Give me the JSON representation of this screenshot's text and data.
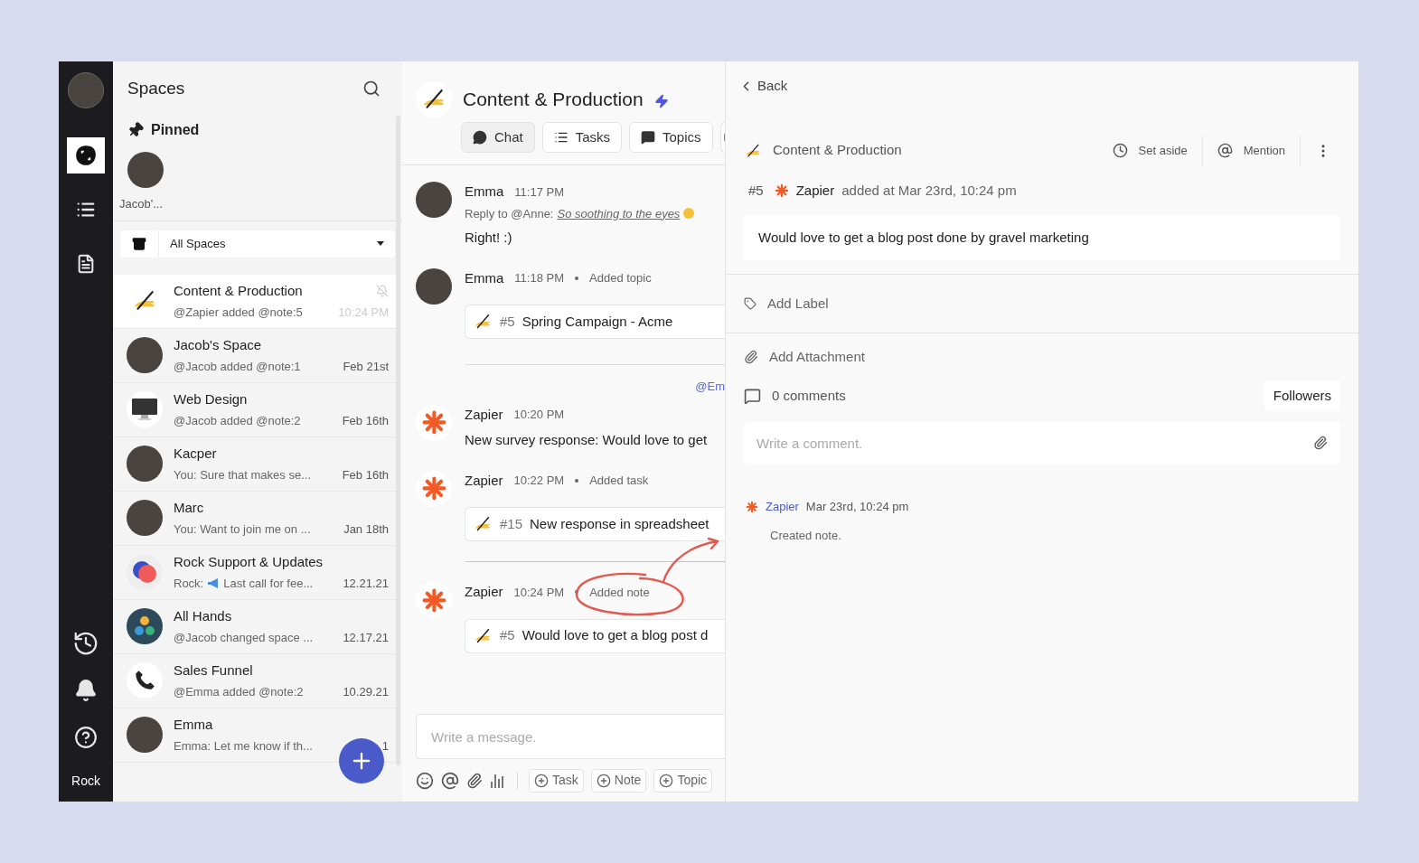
{
  "rail": {
    "top_items": [
      {
        "kind": "spaces",
        "selected": true
      },
      {
        "kind": "tasks",
        "selected": false
      },
      {
        "kind": "files",
        "selected": false
      }
    ],
    "bottom_items": [
      {
        "kind": "history"
      },
      {
        "kind": "notifications"
      },
      {
        "kind": "help"
      }
    ],
    "label": "Rock"
  },
  "spaces": {
    "title": "Spaces",
    "pinned": {
      "title": "Pinned",
      "items": [
        {
          "name": "Jacob'..."
        }
      ]
    },
    "filter": {
      "value": "All Spaces"
    },
    "items": [
      {
        "name": "Content & Production",
        "preview": "@Zapier added @note:5",
        "time": "10:24 PM",
        "avatar": {
          "kind": "writing"
        },
        "selected": true,
        "muted": true
      },
      {
        "name": "Jacob's Space",
        "preview": "@Jacob added @note:1",
        "time": "Feb 21st",
        "avatar": {
          "kind": "person"
        },
        "selected": false,
        "muted": false
      },
      {
        "name": "Web Design",
        "preview": "@Jacob added @note:2",
        "time": "Feb 16th",
        "avatar": {
          "kind": "monitor"
        },
        "selected": false,
        "muted": false
      },
      {
        "name": "Kacper",
        "preview": "You: Sure that makes se...",
        "time": "Feb 16th",
        "avatar": {
          "kind": "person"
        },
        "selected": false,
        "muted": false
      },
      {
        "name": "Marc",
        "preview": "You: Want to join me on ...",
        "time": "Jan 18th",
        "avatar": {
          "kind": "person"
        },
        "selected": false,
        "muted": false
      },
      {
        "name": "Rock Support & Updates",
        "preview_prefix": "Rock:",
        "preview": "Last call for fee...",
        "time": "12.21.21",
        "avatar": {
          "kind": "logo"
        },
        "selected": false,
        "muted": false
      },
      {
        "name": "All Hands",
        "preview": "@Jacob changed space ...",
        "time": "12.17.21",
        "avatar": {
          "kind": "group"
        },
        "selected": false,
        "muted": false
      },
      {
        "name": "Sales Funnel",
        "preview": "@Emma added @note:2",
        "time": "10.29.21",
        "avatar": {
          "kind": "phone"
        },
        "selected": false,
        "muted": false
      },
      {
        "name": "Emma",
        "preview": "Emma: Let me know if th...",
        "time": "1",
        "avatar": {
          "kind": "person"
        },
        "selected": false,
        "muted": false
      }
    ]
  },
  "chat": {
    "title": "Content & Production",
    "tabs": [
      {
        "label": "Chat",
        "kind": "chat",
        "selected": true
      },
      {
        "label": "Tasks",
        "kind": "tasks",
        "selected": false
      },
      {
        "label": "Topics",
        "kind": "topics",
        "selected": false
      },
      {
        "kind": "files",
        "selected": false
      }
    ],
    "feed": [
      {
        "kind": "message",
        "avatar": {
          "kind": "person"
        },
        "author": "Emma",
        "time": "11:17 PM",
        "reply_prefix": "Reply to @Anne:",
        "reply_quote": "So soothing to the eyes",
        "text": "Right! :)"
      },
      {
        "kind": "message",
        "avatar": {
          "kind": "person"
        },
        "author": "Emma",
        "time": "11:18 PM",
        "action": "Added topic",
        "card": {
          "number": "#5",
          "title": "Spring Campaign - Acme"
        }
      },
      {
        "kind": "divider"
      },
      {
        "kind": "mention",
        "text": "@Em"
      },
      {
        "kind": "message",
        "avatar": {
          "kind": "zapier"
        },
        "author": "Zapier",
        "time": "10:20 PM",
        "text": "New survey response: Would love to get"
      },
      {
        "kind": "message",
        "avatar": {
          "kind": "zapier"
        },
        "author": "Zapier",
        "time": "10:22 PM",
        "action": "Added task",
        "card": {
          "number": "#15",
          "title": "New response in spreadsheet"
        }
      },
      {
        "kind": "new-divider"
      },
      {
        "kind": "message",
        "avatar": {
          "kind": "zapier"
        },
        "author": "Zapier",
        "time": "10:24 PM",
        "action": "Added note",
        "highlighted": true,
        "card": {
          "number": "#5",
          "title": "Would love to get a blog post d"
        }
      }
    ],
    "composer": {
      "placeholder": "Write a message.",
      "buttons": [
        "Task",
        "Note",
        "Topic"
      ]
    }
  },
  "detail": {
    "back": "Back",
    "space": "Content & Production",
    "actions": [
      {
        "label": "Set aside",
        "kind": "set-aside"
      },
      {
        "label": "Mention",
        "kind": "mention"
      }
    ],
    "note": {
      "number": "#5",
      "author": "Zapier",
      "meta": "added at Mar 23rd, 10:24 pm",
      "body": "Would love to get a blog post done by gravel marketing"
    },
    "add_label": "Add Label",
    "add_attachment": "Add Attachment",
    "comments": "0 comments",
    "followers": "Followers",
    "comment_placeholder": "Write a comment.",
    "activity": [
      {
        "author": "Zapier",
        "time": "Mar 23rd, 10:24 pm",
        "text": "Created note."
      }
    ]
  }
}
